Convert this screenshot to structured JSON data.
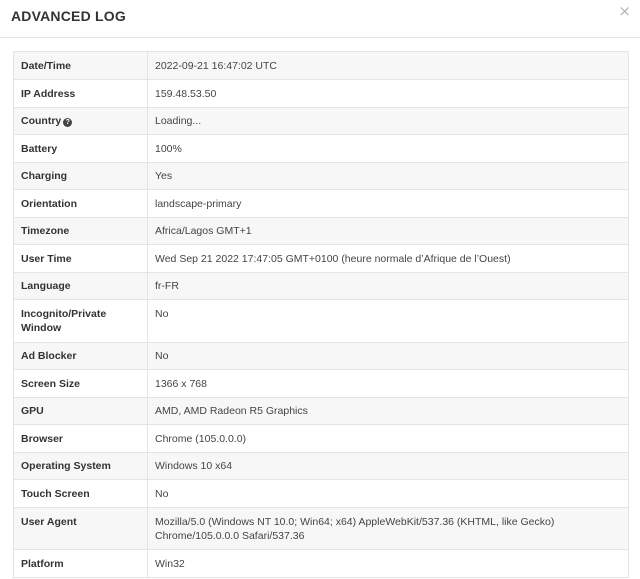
{
  "modal": {
    "title": "ADVANCED LOG",
    "close_label": "×"
  },
  "icons": {
    "help": "question-circle-icon",
    "close": "close-icon"
  },
  "rows": [
    {
      "key": "date_time",
      "label": "Date/Time",
      "value": "2022-09-21 16:47:02 UTC"
    },
    {
      "key": "ip_address",
      "label": "IP Address",
      "value": "159.48.53.50"
    },
    {
      "key": "country",
      "label": "Country",
      "value": "Loading...",
      "help": true
    },
    {
      "key": "battery",
      "label": "Battery",
      "value": "100%"
    },
    {
      "key": "charging",
      "label": "Charging",
      "value": "Yes"
    },
    {
      "key": "orientation",
      "label": "Orientation",
      "value": "landscape-primary"
    },
    {
      "key": "timezone",
      "label": "Timezone",
      "value": "Africa/Lagos GMT+1"
    },
    {
      "key": "user_time",
      "label": "User Time",
      "value": "Wed Sep 21 2022 17:47:05 GMT+0100 (heure normale d’Afrique de l’Ouest)"
    },
    {
      "key": "language",
      "label": "Language",
      "value": "fr-FR"
    },
    {
      "key": "incognito",
      "label": "Incognito/Private Window",
      "value": "No"
    },
    {
      "key": "ad_blocker",
      "label": "Ad Blocker",
      "value": "No"
    },
    {
      "key": "screen_size",
      "label": "Screen Size",
      "value": "1366 x 768"
    },
    {
      "key": "gpu",
      "label": "GPU",
      "value": "AMD, AMD Radeon R5 Graphics"
    },
    {
      "key": "browser",
      "label": "Browser",
      "value": "Chrome (105.0.0.0)"
    },
    {
      "key": "os",
      "label": "Operating System",
      "value": "Windows 10 x64"
    },
    {
      "key": "touch_screen",
      "label": "Touch Screen",
      "value": "No"
    },
    {
      "key": "user_agent",
      "label": "User Agent",
      "value": "Mozilla/5.0 (Windows NT 10.0; Win64; x64) AppleWebKit/537.36 (KHTML, like Gecko) Chrome/105.0.0.0 Safari/537.36"
    },
    {
      "key": "platform",
      "label": "Platform",
      "value": "Win32"
    }
  ]
}
